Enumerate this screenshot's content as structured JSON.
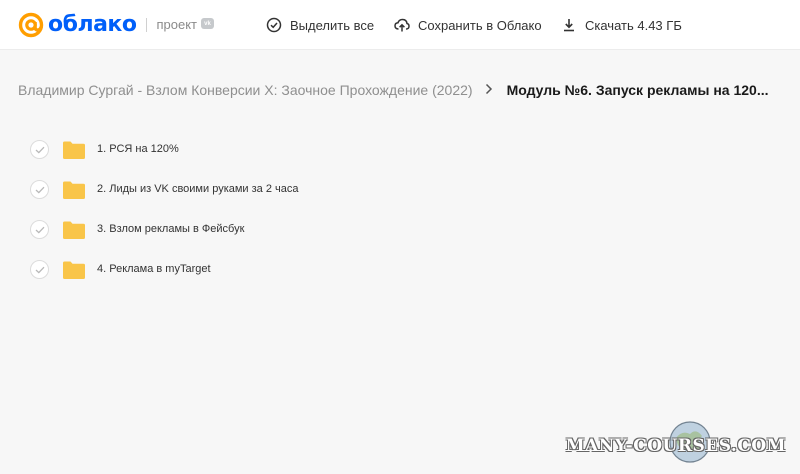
{
  "header": {
    "logo_text": "облако",
    "project_label": "проект",
    "project_badge": "vk",
    "select_all": "Выделить все",
    "save_to_cloud": "Сохранить в Облако",
    "download": "Скачать 4.43 ГБ"
  },
  "breadcrumbs": {
    "root": "Владимир Сургай - Взлом Конверсии Х: Заочное Прохождение (2022)",
    "separator": ">",
    "current": "Модуль №6. Запуск рекламы на 120..."
  },
  "files": [
    {
      "name": "1. РСЯ на 120%"
    },
    {
      "name": "2. Лиды из VK своими руками за 2 часа"
    },
    {
      "name": "3. Взлом рекламы в Фейсбук"
    },
    {
      "name": "4. Реклама в myTarget"
    }
  ],
  "watermark": "MANY-COURSES.COM",
  "colors": {
    "brand_orange": "#ff9e00",
    "brand_blue": "#005ff9",
    "folder": "#f9c549",
    "background": "#f7f7f7"
  }
}
